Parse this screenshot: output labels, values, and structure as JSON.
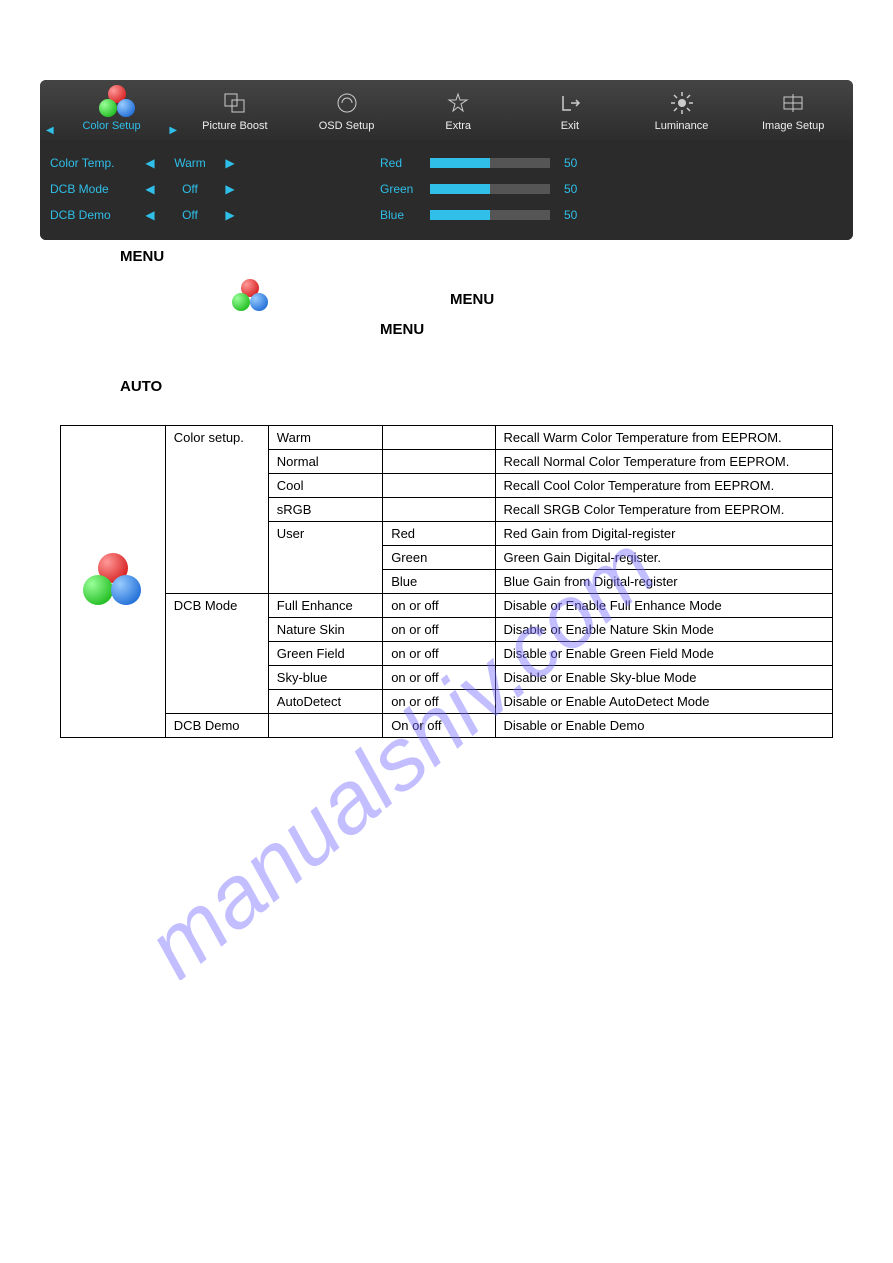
{
  "osd": {
    "tabs": [
      {
        "label": "Color Setup",
        "active": true
      },
      {
        "label": "Picture Boost"
      },
      {
        "label": "OSD Setup"
      },
      {
        "label": "Extra"
      },
      {
        "label": "Exit"
      },
      {
        "label": "Luminance"
      },
      {
        "label": "Image Setup"
      }
    ],
    "left": [
      {
        "name": "Color Temp.",
        "value": "Warm"
      },
      {
        "name": "DCB Mode",
        "value": "Off"
      },
      {
        "name": "DCB Demo",
        "value": "Off"
      }
    ],
    "right": [
      {
        "name": "Red",
        "value": 50,
        "pct": 50
      },
      {
        "name": "Green",
        "value": 50,
        "pct": 50
      },
      {
        "name": "Blue",
        "value": 50,
        "pct": 50
      }
    ]
  },
  "instr": {
    "menu1": "MENU",
    "menu2": "MENU",
    "menu3": "MENU",
    "auto": "AUTO"
  },
  "table": {
    "rows": [
      {
        "c1": "Color setup.",
        "c2": "Warm",
        "c3": "",
        "c4": "Recall Warm Color Temperature from EEPROM."
      },
      {
        "c1": "",
        "c2": "Normal",
        "c3": "",
        "c4": "Recall Normal Color Temperature from EEPROM."
      },
      {
        "c1": "",
        "c2": "Cool",
        "c3": "",
        "c4": "Recall Cool Color Temperature from EEPROM."
      },
      {
        "c1": "",
        "c2": "sRGB",
        "c3": "",
        "c4": "Recall SRGB Color Temperature from EEPROM."
      },
      {
        "c1": "",
        "c2": "User",
        "c3": "Red",
        "c4": "Red Gain from Digital-register"
      },
      {
        "c1": "",
        "c2": "",
        "c3": "Green",
        "c4": "Green Gain Digital-register."
      },
      {
        "c1": "",
        "c2": "",
        "c3": "Blue",
        "c4": "Blue Gain from Digital-register"
      },
      {
        "c1": "DCB Mode",
        "c2": "Full Enhance",
        "c3": "on or off",
        "c4": "Disable or Enable Full Enhance Mode"
      },
      {
        "c1": "",
        "c2": "Nature Skin",
        "c3": "on or off",
        "c4": "Disable or Enable Nature Skin Mode"
      },
      {
        "c1": "",
        "c2": "Green Field",
        "c3": "on or off",
        "c4": "Disable or Enable Green Field Mode"
      },
      {
        "c1": "",
        "c2": "Sky-blue",
        "c3": "on or off",
        "c4": "Disable or Enable Sky-blue Mode"
      },
      {
        "c1": "",
        "c2": "AutoDetect",
        "c3": "on or off",
        "c4": "Disable or Enable AutoDetect Mode"
      },
      {
        "c1": "DCB Demo",
        "c2": "",
        "c3": "On or off",
        "c4": "Disable or Enable Demo"
      }
    ]
  }
}
